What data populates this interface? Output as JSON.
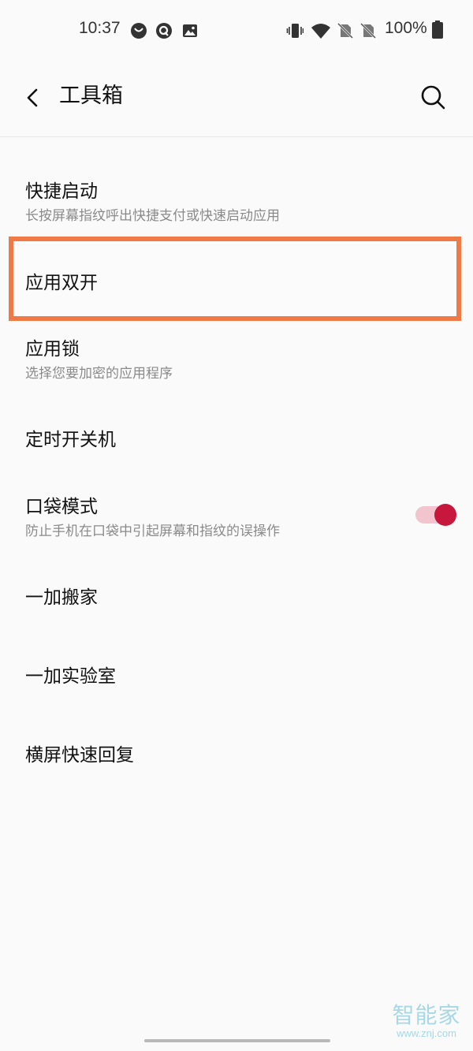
{
  "status_bar": {
    "time": "10:37",
    "battery_text": "100%",
    "icons": [
      "notification-circle-icon",
      "quora-icon",
      "image-icon",
      "vibrate-icon",
      "wifi-icon",
      "no-sim-icon",
      "no-sim-icon",
      "battery-icon"
    ]
  },
  "app_bar": {
    "title": "工具箱",
    "back_icon": "chevron-left-icon",
    "search_icon": "search-icon"
  },
  "items": [
    {
      "title": "快捷启动",
      "subtitle": "长按屏幕指纹呼出快捷支付或快速启动应用"
    },
    {
      "title": "应用双开",
      "subtitle": ""
    },
    {
      "title": "应用锁",
      "subtitle": "选择您要加密的应用程序"
    },
    {
      "title": "定时开关机",
      "subtitle": ""
    },
    {
      "title": "口袋模式",
      "subtitle": "防止手机在口袋中引起屏幕和指纹的误操作",
      "toggle_on": true
    },
    {
      "title": "一加搬家",
      "subtitle": ""
    },
    {
      "title": "一加实验室",
      "subtitle": ""
    },
    {
      "title": "横屏快速回复",
      "subtitle": ""
    }
  ],
  "colors": {
    "highlight_border": "#f07a45",
    "toggle_thumb": "#c8173d",
    "toggle_track": "#f2c4cd"
  },
  "watermark": {
    "main": "智能家",
    "sub": "www.znj.com"
  }
}
